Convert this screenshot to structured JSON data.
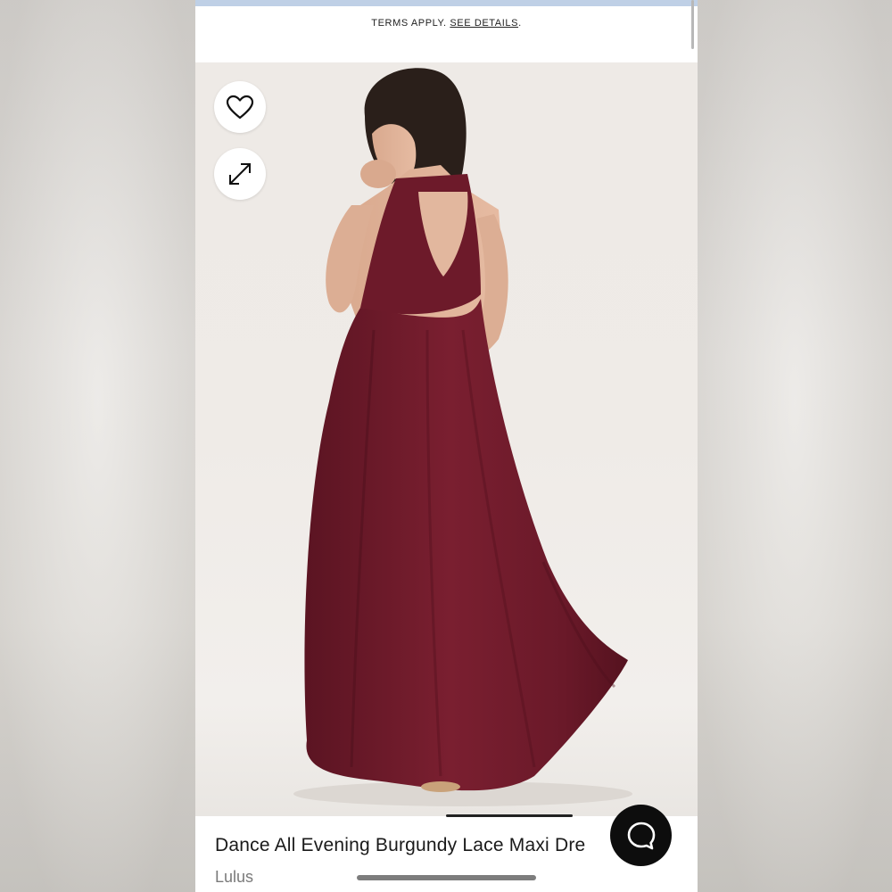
{
  "banner": {
    "terms_text": "TERMS APPLY.",
    "details_link": "SEE DETAILS",
    "details_suffix": "."
  },
  "product": {
    "title": "Dance All Evening Burgundy Lace Maxi Dre",
    "brand": "Lulus",
    "color_hex": "#6e1a2a"
  },
  "icons": {
    "favorite": "heart-icon",
    "expand": "expand-arrows-icon",
    "chat": "chat-bubble-icon"
  },
  "colors": {
    "banner_strip": "#bfd0e6",
    "chat_button": "#0d0d0d",
    "dress": "#6e1a2a"
  }
}
